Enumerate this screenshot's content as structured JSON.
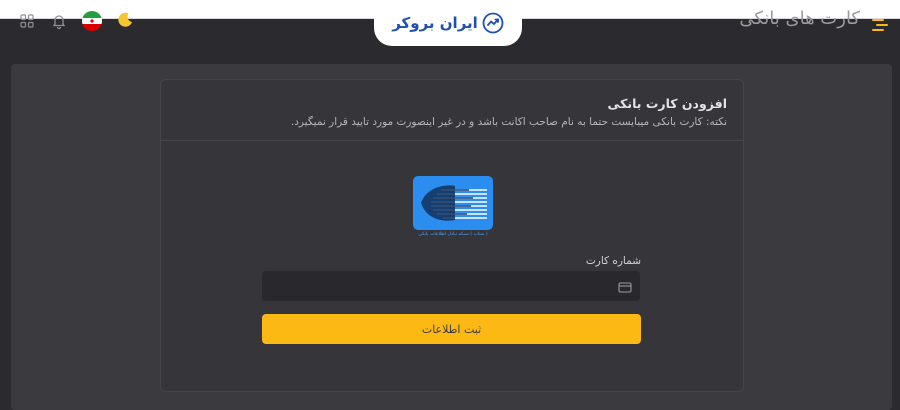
{
  "header": {
    "logo_text": "ایران بروکر",
    "page_title": "کارت های بانکی"
  },
  "form": {
    "title": "افزودن کارت بانکی",
    "note": "نکته: کارت بانکی میبایست حتما به نام صاحب اکانت باشد و در غیر اینصورت مورد تایید قرار نمیگیرد.",
    "bank_network_caption": "( شتاب ) شبکه تبادل اطلاعات بانکی",
    "card_number_label": "شماره کارت",
    "card_number_value": "",
    "submit_label": "ثبت اطلاعات"
  },
  "colors": {
    "accent": "#fdb913",
    "brand_blue": "#2c8df0",
    "logo_blue": "#1f4fb5",
    "background": "#2b2b2f"
  },
  "icons": [
    "grid-icon",
    "bell-icon",
    "iran-flag-icon",
    "moon-icon",
    "menu-icon",
    "credit-card-icon",
    "shetab-logo-icon",
    "broker-logo-icon"
  ]
}
